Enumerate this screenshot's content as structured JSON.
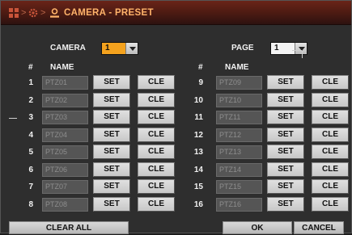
{
  "title": {
    "breadcrumb_icons": [
      "grid-icon",
      "gear-icon",
      "user-icon"
    ],
    "text": "CAMERA - PRESET"
  },
  "camera": {
    "label": "CAMERA",
    "value": "1"
  },
  "page": {
    "label": "PAGE",
    "value": "1"
  },
  "headers": {
    "num": "#",
    "name": "NAME"
  },
  "buttons": {
    "set": "SET",
    "cle": "CLE"
  },
  "presets_left": [
    {
      "num": "1",
      "name": "PTZ01"
    },
    {
      "num": "2",
      "name": "PTZ02"
    },
    {
      "num": "3",
      "name": "PTZ03"
    },
    {
      "num": "4",
      "name": "PTZ04"
    },
    {
      "num": "5",
      "name": "PTZ05"
    },
    {
      "num": "6",
      "name": "PTZ06"
    },
    {
      "num": "7",
      "name": "PTZ07"
    },
    {
      "num": "8",
      "name": "PTZ08"
    }
  ],
  "presets_right": [
    {
      "num": "9",
      "name": "PTZ09"
    },
    {
      "num": "10",
      "name": "PTZ10"
    },
    {
      "num": "11",
      "name": "PTZ11"
    },
    {
      "num": "12",
      "name": "PTZ12"
    },
    {
      "num": "13",
      "name": "PTZ13"
    },
    {
      "num": "14",
      "name": "PTZ14"
    },
    {
      "num": "15",
      "name": "PTZ15"
    },
    {
      "num": "16",
      "name": "PTZ16"
    }
  ],
  "footer": {
    "clear_all": "CLEAR ALL",
    "ok": "OK",
    "cancel": "CANCEL"
  },
  "colors": {
    "accent": "#f4a21e",
    "title_bar": "#4a1a12",
    "title_text": "#ffb36a"
  }
}
